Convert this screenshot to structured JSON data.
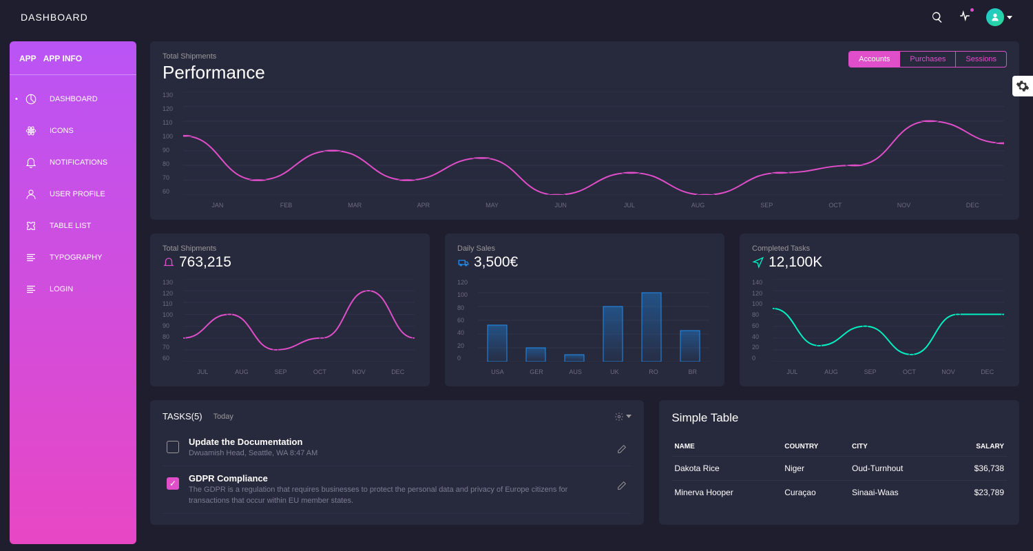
{
  "topbar": {
    "title": "DASHBOARD"
  },
  "sidebar": {
    "brand_a": "APP",
    "brand_b": "APP INFO",
    "items": [
      {
        "label": "DASHBOARD"
      },
      {
        "label": "ICONS"
      },
      {
        "label": "NOTIFICATIONS"
      },
      {
        "label": "USER PROFILE"
      },
      {
        "label": "TABLE LIST"
      },
      {
        "label": "TYPOGRAPHY"
      },
      {
        "label": "LOGIN"
      }
    ]
  },
  "performance": {
    "subtitle": "Total Shipments",
    "title": "Performance",
    "tabs": [
      {
        "label": "Accounts"
      },
      {
        "label": "Purchases"
      },
      {
        "label": "Sessions"
      }
    ]
  },
  "cards": {
    "shipments": {
      "subtitle": "Total Shipments",
      "value": "763,215"
    },
    "sales": {
      "subtitle": "Daily Sales",
      "value": "3,500€"
    },
    "tasks": {
      "subtitle": "Completed Tasks",
      "value": "12,100K"
    }
  },
  "tasksPanel": {
    "title": "TASKS(5)",
    "subtitle": "Today",
    "items": [
      {
        "title": "Update the Documentation",
        "desc": "Dwuamish Head, Seattle, WA 8:47 AM",
        "checked": false
      },
      {
        "title": "GDPR Compliance",
        "desc": "The GDPR is a regulation that requires businesses to protect the personal data and privacy of Europe citizens for transactions that occur within EU member states.",
        "checked": true
      }
    ]
  },
  "table": {
    "title": "Simple Table",
    "headers": [
      "NAME",
      "COUNTRY",
      "CITY",
      "SALARY"
    ],
    "rows": [
      {
        "name": "Dakota Rice",
        "country": "Niger",
        "city": "Oud-Turnhout",
        "salary": "$36,738"
      },
      {
        "name": "Minerva Hooper",
        "country": "Curaçao",
        "city": "Sinaai-Waas",
        "salary": "$23,789"
      }
    ]
  },
  "chart_data": [
    {
      "id": "performance",
      "type": "line",
      "categories": [
        "JAN",
        "FEB",
        "MAR",
        "APR",
        "MAY",
        "JUN",
        "JUL",
        "AUG",
        "SEP",
        "OCT",
        "NOV",
        "DEC"
      ],
      "values": [
        100,
        70,
        90,
        70,
        85,
        60,
        75,
        60,
        75,
        80,
        110,
        95
      ],
      "ylim": [
        60,
        130
      ],
      "yticks": [
        60,
        70,
        80,
        90,
        100,
        110,
        120,
        130
      ],
      "color": "#e14eca"
    },
    {
      "id": "shipments",
      "type": "line",
      "categories": [
        "JUL",
        "AUG",
        "SEP",
        "OCT",
        "NOV",
        "DEC"
      ],
      "values": [
        80,
        100,
        70,
        80,
        120,
        80
      ],
      "ylim": [
        60,
        130
      ],
      "yticks": [
        60,
        70,
        80,
        90,
        100,
        110,
        120,
        130
      ],
      "color": "#e14eca"
    },
    {
      "id": "sales",
      "type": "bar",
      "categories": [
        "USA",
        "GER",
        "AUS",
        "UK",
        "RO",
        "BR"
      ],
      "values": [
        53,
        20,
        10,
        80,
        100,
        45
      ],
      "ylim": [
        0,
        120
      ],
      "yticks": [
        0,
        20,
        40,
        60,
        80,
        100,
        120
      ],
      "color": "#1f8ef1"
    },
    {
      "id": "tasks",
      "type": "line",
      "categories": [
        "JUL",
        "AUG",
        "SEP",
        "OCT",
        "NOV",
        "DEC"
      ],
      "values": [
        90,
        27,
        60,
        12,
        80,
        80
      ],
      "ylim": [
        0,
        140
      ],
      "yticks": [
        0,
        20,
        40,
        60,
        80,
        100,
        120,
        140
      ],
      "color": "#00f2c3"
    }
  ]
}
